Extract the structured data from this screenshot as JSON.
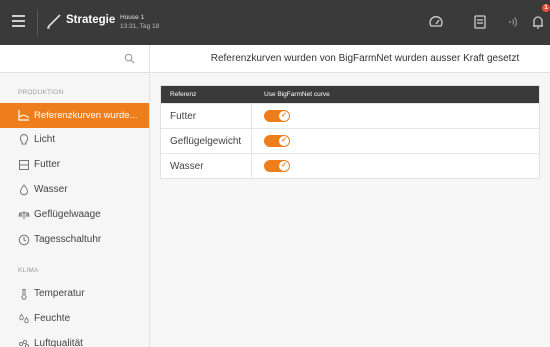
{
  "topbar": {
    "title": "Strategie",
    "house": "House 1",
    "time": "13:31, Tag 18",
    "badge": "1",
    "icons": [
      "menu-icon",
      "strategy-icon",
      "gauge-icon",
      "document-icon",
      "wifi-icon",
      "bell-icon"
    ]
  },
  "sidebar": {
    "section_production": "PRODUKTION",
    "section_climate": "KLIMA",
    "items_production": [
      {
        "label": "Referenzkurven wurde...",
        "icon": "curve-icon",
        "active": true
      },
      {
        "label": "Licht",
        "icon": "bulb-icon"
      },
      {
        "label": "Futter",
        "icon": "feed-icon"
      },
      {
        "label": "Wasser",
        "icon": "water-drop-icon"
      },
      {
        "label": "Geflügelwaage",
        "icon": "scale-icon"
      },
      {
        "label": "Tagesschaltuhr",
        "icon": "clock-icon"
      }
    ],
    "items_climate": [
      {
        "label": "Temperatur",
        "icon": "thermometer-icon"
      },
      {
        "label": "Feuchte",
        "icon": "humidity-icon"
      },
      {
        "label": "Luftqualität",
        "icon": "air-quality-icon"
      }
    ]
  },
  "main": {
    "title": "Referenzkurven wurden von BigFarmNet wurden ausser Kraft gesetzt",
    "table": {
      "headers": [
        "Referenz",
        "Use BigFarmNet curve"
      ],
      "rows": [
        {
          "label": "Futter",
          "enabled": true
        },
        {
          "label": "Geflügelgewicht",
          "enabled": true
        },
        {
          "label": "Wasser",
          "enabled": true
        }
      ]
    }
  },
  "colors": {
    "accent": "#ee7d1b",
    "topbar": "#3a3a3a",
    "background": "#f6f6f6"
  }
}
